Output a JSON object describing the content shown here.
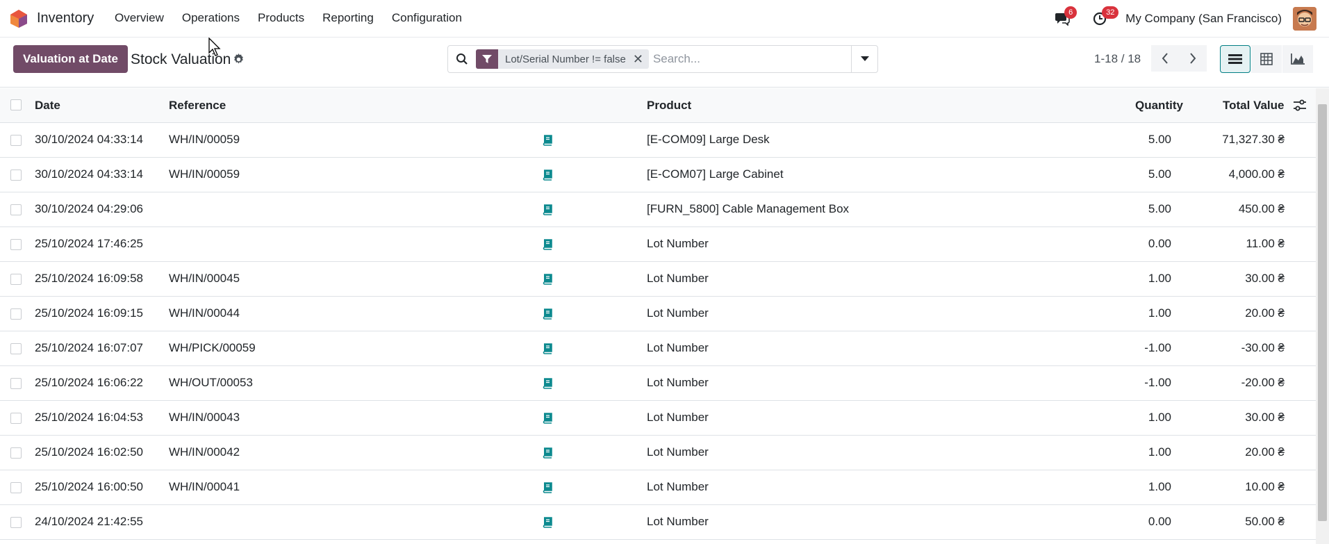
{
  "navbar": {
    "app_name": "Inventory",
    "menu": [
      "Overview",
      "Operations",
      "Products",
      "Reporting",
      "Configuration"
    ],
    "messages_count": "6",
    "activities_count": "32",
    "company": "My Company (San Francisco)"
  },
  "control": {
    "primary_button": "Valuation at Date",
    "title": "Stock Valuation",
    "facet_label": "Lot/Serial Number != false",
    "search_placeholder": "Search...",
    "pager": "1-18 / 18"
  },
  "table": {
    "headers": {
      "date": "Date",
      "reference": "Reference",
      "product": "Product",
      "quantity": "Quantity",
      "total_value": "Total Value"
    },
    "rows": [
      {
        "date": "30/10/2024 04:33:14",
        "reference": "WH/IN/00059",
        "product": "[E-COM09] Large Desk",
        "quantity": "5.00",
        "value": "71,327.30 ₴"
      },
      {
        "date": "30/10/2024 04:33:14",
        "reference": "WH/IN/00059",
        "product": "[E-COM07] Large Cabinet",
        "quantity": "5.00",
        "value": "4,000.00 ₴"
      },
      {
        "date": "30/10/2024 04:29:06",
        "reference": "",
        "product": "[FURN_5800] Cable Management Box",
        "quantity": "5.00",
        "value": "450.00 ₴"
      },
      {
        "date": "25/10/2024 17:46:25",
        "reference": "",
        "product": "Lot Number",
        "quantity": "0.00",
        "value": "11.00 ₴"
      },
      {
        "date": "25/10/2024 16:09:58",
        "reference": "WH/IN/00045",
        "product": "Lot Number",
        "quantity": "1.00",
        "value": "30.00 ₴"
      },
      {
        "date": "25/10/2024 16:09:15",
        "reference": "WH/IN/00044",
        "product": "Lot Number",
        "quantity": "1.00",
        "value": "20.00 ₴"
      },
      {
        "date": "25/10/2024 16:07:07",
        "reference": "WH/PICK/00059",
        "product": "Lot Number",
        "quantity": "-1.00",
        "value": "-30.00 ₴"
      },
      {
        "date": "25/10/2024 16:06:22",
        "reference": "WH/OUT/00053",
        "product": "Lot Number",
        "quantity": "-1.00",
        "value": "-20.00 ₴"
      },
      {
        "date": "25/10/2024 16:04:53",
        "reference": "WH/IN/00043",
        "product": "Lot Number",
        "quantity": "1.00",
        "value": "30.00 ₴"
      },
      {
        "date": "25/10/2024 16:02:50",
        "reference": "WH/IN/00042",
        "product": "Lot Number",
        "quantity": "1.00",
        "value": "20.00 ₴"
      },
      {
        "date": "25/10/2024 16:00:50",
        "reference": "WH/IN/00041",
        "product": "Lot Number",
        "quantity": "1.00",
        "value": "10.00 ₴"
      },
      {
        "date": "24/10/2024 21:42:55",
        "reference": "",
        "product": "Lot Number",
        "quantity": "0.00",
        "value": "50.00 ₴"
      }
    ]
  },
  "colors": {
    "brand": "#714b67",
    "accent": "#017e84",
    "badge": "#d9323c",
    "book_icon": "#0d8a8f"
  },
  "icons": [
    "app-logo-icon",
    "chat-icon",
    "clock-icon",
    "gear-icon",
    "search-icon",
    "filter-icon",
    "close-icon",
    "caret-down-icon",
    "chevron-left-icon",
    "chevron-right-icon",
    "list-view-icon",
    "pivot-view-icon",
    "graph-view-icon",
    "optional-columns-icon",
    "book-icon"
  ]
}
